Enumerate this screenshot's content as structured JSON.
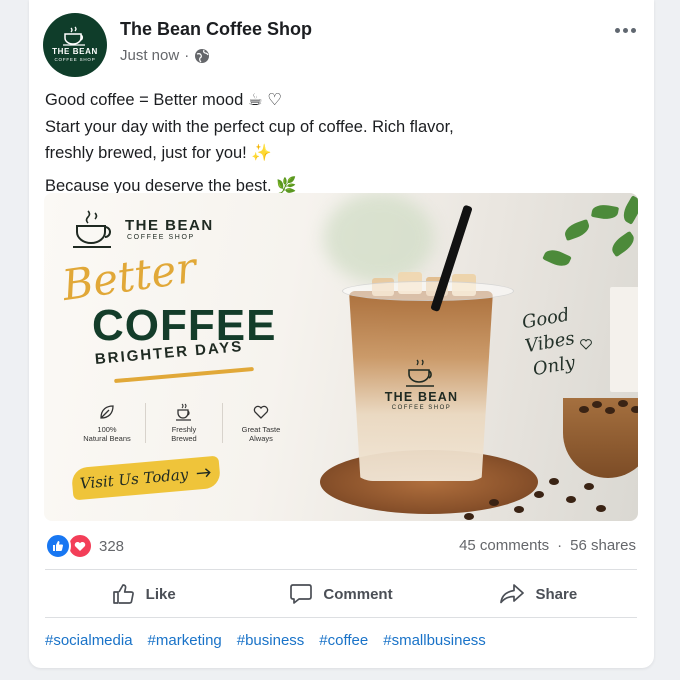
{
  "post": {
    "page_name": "The Bean Coffee Shop",
    "timestamp": "Just now",
    "audience_icon": "globe-icon",
    "avatar": {
      "name": "THE BEAN",
      "sub": "COFFEE SHOP"
    },
    "text_lines": [
      "Good coffee = Better mood ☕ ♡",
      "Start your day with the perfect cup of coffee. Rich flavor,",
      "freshly brewed, just for you! ✨",
      "Because you deserve the best. 🌿"
    ]
  },
  "ad": {
    "brand_name": "THE BEAN",
    "brand_sub": "COFFEE SHOP",
    "headline_script": "Better",
    "headline_main": "COFFEE",
    "headline_sub": "BRIGHTER DAYS",
    "features": [
      {
        "icon": "leaf-icon",
        "label": "100%\nNatural Beans"
      },
      {
        "icon": "coffee-cup-icon",
        "label": "Freshly\nBrewed"
      },
      {
        "icon": "heart-icon",
        "label": "Great Taste\nAlways"
      }
    ],
    "cta": "Visit Us Today",
    "side_script": [
      "Good",
      "Vibes",
      "Only"
    ],
    "cup_brand": "THE BEAN",
    "cup_sub": "COFFEE SHOP"
  },
  "engagement": {
    "reaction_count": "328",
    "comments": "45 comments",
    "separator": "·",
    "shares": "56 shares"
  },
  "actions": {
    "like": "Like",
    "comment": "Comment",
    "share": "Share"
  },
  "hashtags": [
    "#socialmedia",
    "#marketing",
    "#business",
    "#coffee",
    "#smallbusiness"
  ],
  "colors": {
    "brand_green": "#0f3d2a",
    "accent_gold": "#e1a838",
    "like_blue": "#1877f2",
    "love_red": "#f33e58",
    "link_blue": "#1a73c8"
  }
}
